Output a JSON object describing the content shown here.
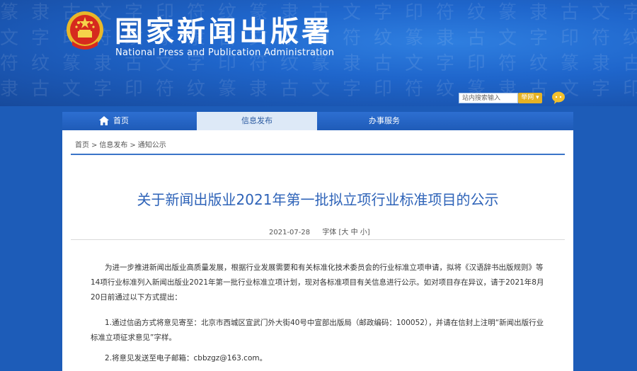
{
  "header": {
    "title_cn": "国家新闻出版署",
    "title_en": "National Press and Publication Administration",
    "search_placeholder": "站内搜索输入",
    "search_button": "举网",
    "brand_color": "#1f66cc",
    "emblem_icon": "national-emblem",
    "chat_icon": "chat-bubble-icon"
  },
  "nav": {
    "home": "首页",
    "news": "信息发布",
    "service": "办事服务"
  },
  "breadcrumb": [
    "首页",
    "信息发布",
    "通知公示"
  ],
  "article": {
    "title": "关于新闻出版业2021年第一批拟立项行业标准项目的公示",
    "date": "2021-07-28",
    "font_label": "字体",
    "font_sizes": "[大 中 小]",
    "para1": "为进一步推进新闻出版业高质量发展，根据行业发展需要和有关标准化技术委员会的行业标准立项申请，拟将《汉语辞书出版规则》等14项行业标准列入新闻出版业2021年第一批行业标准立项计划，现对各标准项目有关信息进行公示。如对项目存在异议，请于2021年8月20日前通过以下方式提出：",
    "para2": "1.通过信函方式将意见寄至：北京市西城区宣武门外大街40号中宣部出版局（邮政编码：100052），并请在信封上注明“新闻出版行业标准立项征求意见”字样。",
    "para3": "2.将意见发送至电子邮箱：cbbzgz@163.com。"
  }
}
